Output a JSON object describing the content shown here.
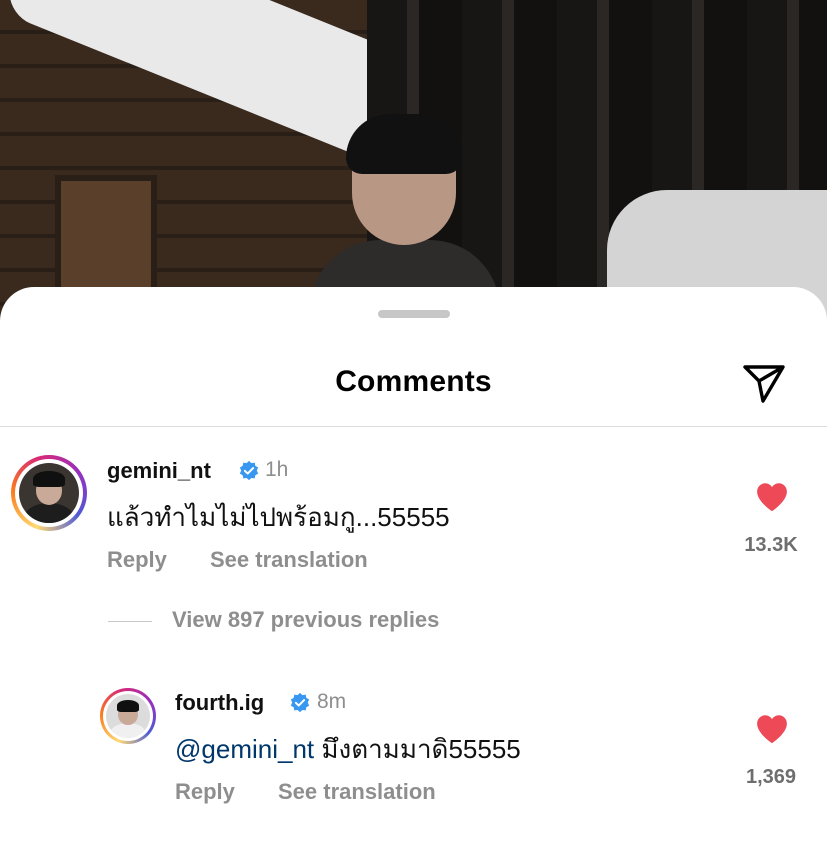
{
  "sheet": {
    "title": "Comments"
  },
  "comments": [
    {
      "username": "gemini_nt",
      "time": "1h",
      "text": "แล้วทำไมไม่ไปพร้อมกู...55555",
      "likes": "13.3K",
      "reply_label": "Reply",
      "translate_label": "See translation"
    }
  ],
  "view_replies": "View 897 previous replies",
  "replies": [
    {
      "username": "fourth.ig",
      "time": "8m",
      "mention": "@gemini_nt",
      "text": " มึงตามมาดิ55555",
      "likes": "1,369",
      "reply_label": "Reply",
      "translate_label": "See translation"
    }
  ],
  "colors": {
    "heart": "#ed4956",
    "verified": "#3897f0",
    "mention": "#00376b",
    "secondary_text": "#8e8e8e"
  },
  "icons": [
    "send-icon",
    "verified-badge-icon",
    "heart-icon"
  ]
}
